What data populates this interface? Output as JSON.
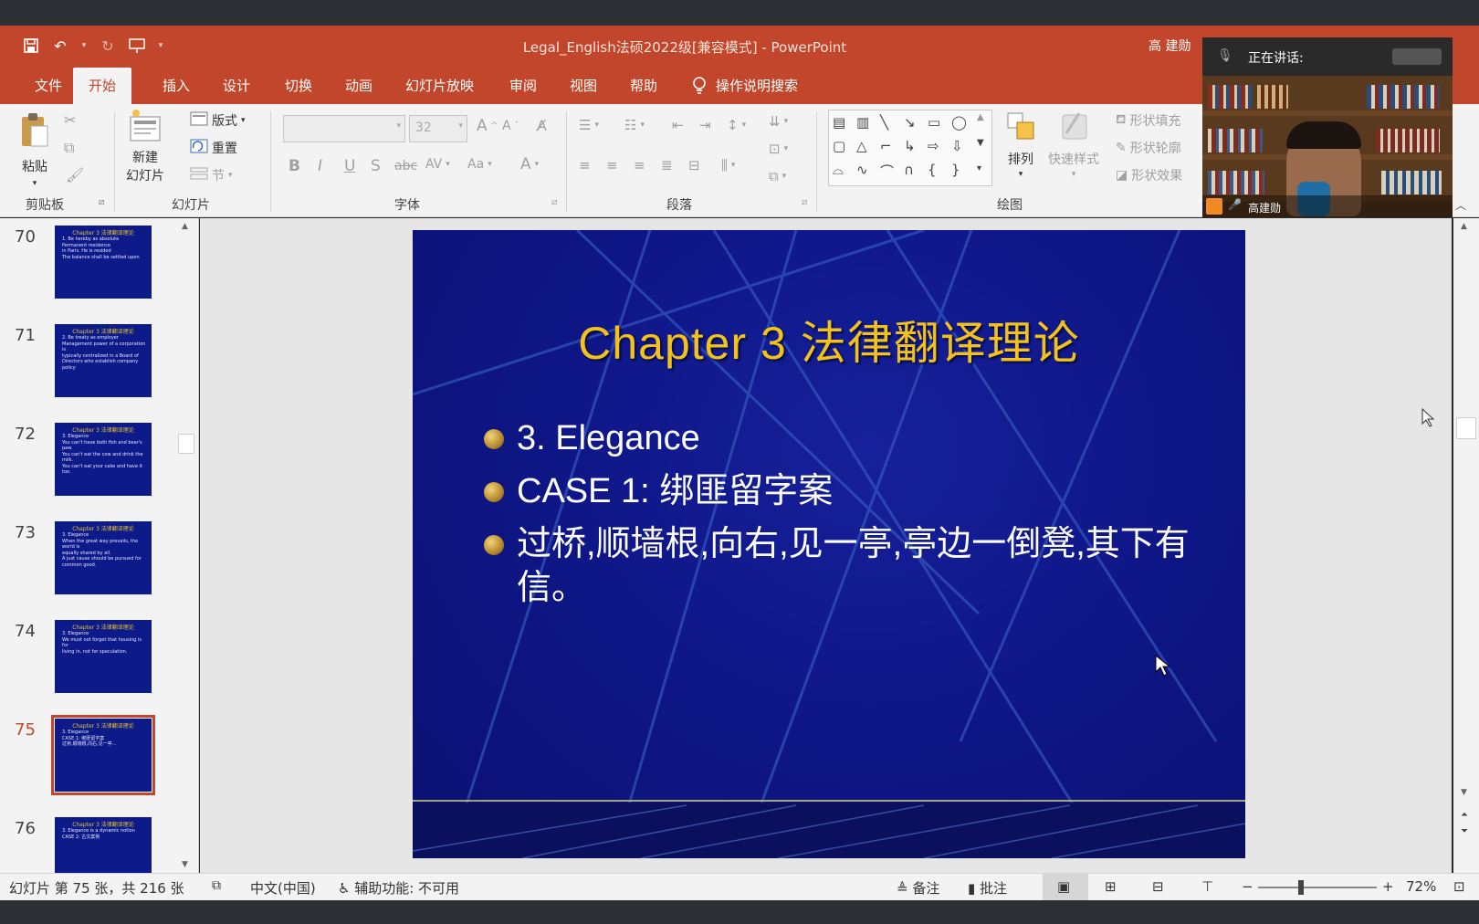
{
  "window": {
    "doc_title": "Legal_English法硕2022级[兼容模式]  -  PowerPoint",
    "user": "高 建勋"
  },
  "tabs": [
    "文件",
    "开始",
    "插入",
    "设计",
    "切换",
    "动画",
    "幻灯片放映",
    "审阅",
    "视图",
    "帮助",
    "操作说明搜索"
  ],
  "active_tab": "开始",
  "ribbon": {
    "clipboard": {
      "paste": "粘贴",
      "label": "剪贴板"
    },
    "slides": {
      "new_slide_1": "新建",
      "new_slide_2": "幻灯片",
      "layout": "版式",
      "reset": "重置",
      "section": "节",
      "label": "幻灯片"
    },
    "font": {
      "size": "32",
      "label": "字体",
      "bold": "B",
      "italic": "I",
      "underline": "U",
      "shadow": "S",
      "strike": "abc",
      "spacing": "AV",
      "case": "Aa",
      "color": "A"
    },
    "paragraph": {
      "label": "段落"
    },
    "drawing": {
      "arrange": "排列",
      "quick_styles": "快速样式",
      "shape_fill": "形状填充",
      "shape_outline": "形状轮廓",
      "shape_effects": "形状效果",
      "label": "绘图"
    }
  },
  "slide_thumbs": [
    {
      "num": "70",
      "title": "Chapter 3 法律翻译理论",
      "lines": "1. Be hereby as absolute\nPermanent residence\nin Paris. He is resided\nThe balance shall be settled upon"
    },
    {
      "num": "71",
      "title": "Chapter 3 法律翻译理论",
      "lines": "2. Be treaty as employer\nManagement power of a corporation is\ntypically centralized in a Board of\nDirectors who establish company policy"
    },
    {
      "num": "72",
      "title": "Chapter 3 法律翻译理论",
      "lines": "3. Elegance\nYou can't have both fish and bear's paw.\nYou can't eat the cow and drink the milk.\nYou can't eat your cake and have it too."
    },
    {
      "num": "73",
      "title": "Chapter 3 法律翻译理论",
      "lines": "3. Elegance\nWhen the great way prevails, the world is\nequally shared by all.\nA just cause should be pursued for\ncommon good."
    },
    {
      "num": "74",
      "title": "Chapter 3 法律翻译理论",
      "lines": "3. Elegance\nWe must not forget that housing is for\nliving in, not for speculation."
    },
    {
      "num": "75",
      "title": "Chapter 3 法律翻译理论",
      "lines": "3. Elegance\nCASE 1: 绑匪留字案\n过桥,顺墙根,向右,见一亭..."
    },
    {
      "num": "76",
      "title": "Chapter 3 法律翻译理论",
      "lines": "3. Elegance is a dynamic notion\nCASE 2: 古文案例"
    }
  ],
  "selected_slide": "75",
  "slide": {
    "title": "Chapter 3 法律翻译理论",
    "bullets": [
      "3. Elegance",
      "CASE 1: 绑匪留字案",
      "过桥,顺墙根,向右,见一亭,亭边一倒凳,其下有信。"
    ]
  },
  "status": {
    "slide_count": "幻灯片 第 75 张，共 216 张",
    "language": "中文(中国)",
    "accessibility": "辅助功能: 不可用",
    "notes": "备注",
    "comments": "批注",
    "zoom": "72%"
  },
  "video": {
    "speaking": "正在讲话:",
    "name": "高建勋"
  },
  "colors": {
    "accent": "#c1462b",
    "slide_bg": "#0f1788",
    "slide_title": "#f2c21b"
  }
}
